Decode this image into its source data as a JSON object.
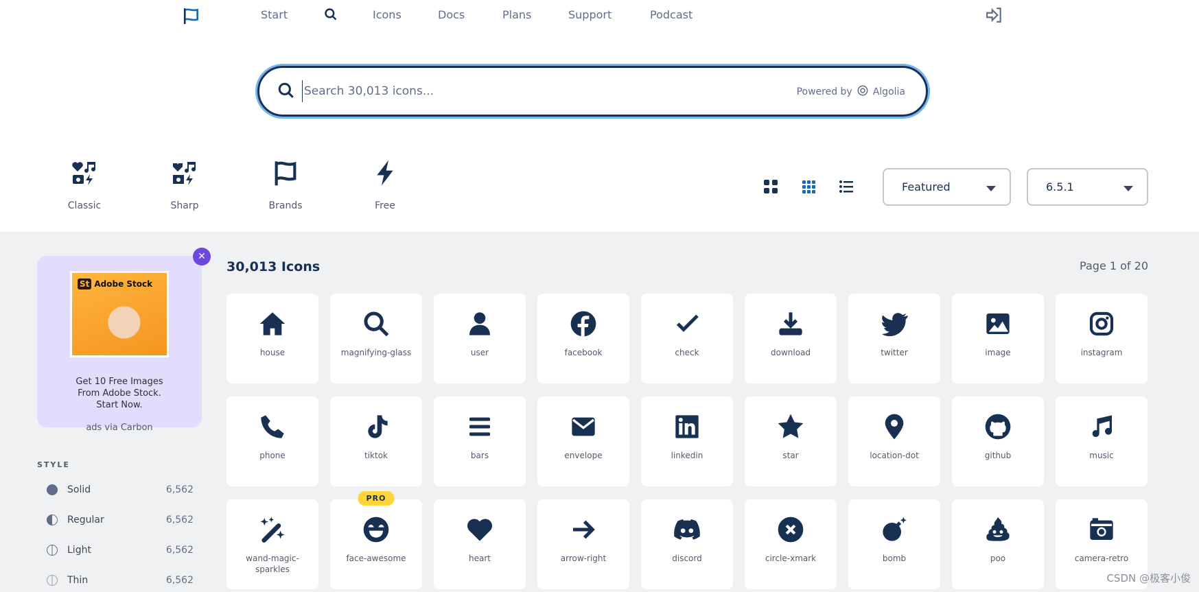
{
  "nav": {
    "items": [
      "Start",
      "Icons",
      "Docs",
      "Plans",
      "Support",
      "Podcast"
    ]
  },
  "search": {
    "placeholder": "Search 30,013 icons...",
    "value": "",
    "powered_by": "Powered by",
    "provider": "Algolia"
  },
  "families": [
    {
      "label": "Classic"
    },
    {
      "label": "Sharp"
    },
    {
      "label": "Brands"
    },
    {
      "label": "Free"
    }
  ],
  "sort": {
    "selected": "Featured"
  },
  "version": {
    "selected": "6.5.1"
  },
  "ad": {
    "brand": "Adobe Stock",
    "brand_mark": "St",
    "text_lines": [
      "Get 10 Free Images",
      "From Adobe Stock.",
      "Start Now."
    ],
    "via": "ads via Carbon"
  },
  "style": {
    "heading": "STYLE",
    "items": [
      {
        "label": "Solid",
        "count": "6,562"
      },
      {
        "label": "Regular",
        "count": "6,562"
      },
      {
        "label": "Light",
        "count": "6,562"
      },
      {
        "label": "Thin",
        "count": "6,562"
      }
    ]
  },
  "results": {
    "count": "30,013 Icons",
    "page": "Page 1 of 20"
  },
  "icons": [
    {
      "name": "house"
    },
    {
      "name": "magnifying-glass"
    },
    {
      "name": "user"
    },
    {
      "name": "facebook"
    },
    {
      "name": "check"
    },
    {
      "name": "download"
    },
    {
      "name": "twitter"
    },
    {
      "name": "image"
    },
    {
      "name": "instagram"
    },
    {
      "name": "phone"
    },
    {
      "name": "tiktok"
    },
    {
      "name": "bars"
    },
    {
      "name": "envelope"
    },
    {
      "name": "linkedin"
    },
    {
      "name": "star"
    },
    {
      "name": "location-dot"
    },
    {
      "name": "github"
    },
    {
      "name": "music"
    },
    {
      "name": "wand-magic-sparkles"
    },
    {
      "name": "face-awesome",
      "badge": "PRO"
    },
    {
      "name": "heart"
    },
    {
      "name": "arrow-right"
    },
    {
      "name": "discord"
    },
    {
      "name": "circle-xmark"
    },
    {
      "name": "bomb"
    },
    {
      "name": "poo"
    },
    {
      "name": "camera-retro"
    }
  ],
  "watermark": "CSDN @极客小俊",
  "colors": {
    "icon": "#183153",
    "accent": "#146ebe",
    "pro": "#ffd43b",
    "ad_bg": "#e3dcfd"
  }
}
